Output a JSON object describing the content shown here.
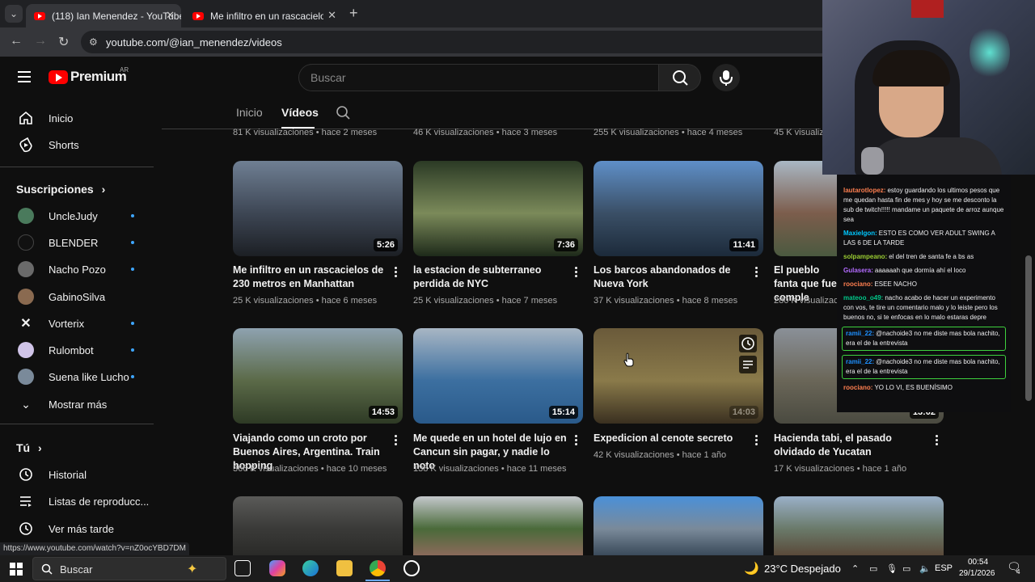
{
  "browser": {
    "tabs": [
      {
        "title": "(118) Ian Menendez - YouTube",
        "active": true
      },
      {
        "title": "Me infiltro en un rascacielos de",
        "active": false
      }
    ],
    "url": "youtube.com/@ian_menendez/videos",
    "status_url": "https://www.youtube.com/watch?v=nZ0ocYBD7DM"
  },
  "youtube": {
    "logo_text": "Premium",
    "country": "AR",
    "search_placeholder": "Buscar"
  },
  "sidebar": {
    "main": [
      {
        "label": "Inicio",
        "icon": "home-icon"
      },
      {
        "label": "Shorts",
        "icon": "shorts-icon"
      }
    ],
    "subscriptions_heading": "Suscripciones",
    "subscriptions": [
      {
        "label": "UncleJudy",
        "color": "#4a7a5c"
      },
      {
        "label": "BLENDER",
        "color": "#111111"
      },
      {
        "label": "Nacho Pozo",
        "color": "#6a6a6a"
      },
      {
        "label": "GabinoSilva",
        "color": "#8a6a50"
      },
      {
        "label": "Vorterix",
        "color": "#0f0f0f"
      },
      {
        "label": "Rulombot",
        "color": "#d0c4e8"
      },
      {
        "label": "Suena like Lucho",
        "color": "#7a8a9a"
      }
    ],
    "show_more": "Mostrar más",
    "you_heading": "Tú",
    "you": [
      {
        "label": "Historial",
        "icon": "history-icon"
      },
      {
        "label": "Listas de reproducc...",
        "icon": "playlists-icon"
      },
      {
        "label": "Ver más tarde",
        "icon": "watch-later-icon"
      }
    ]
  },
  "channel_tabs": [
    {
      "label": "Inicio",
      "active": false
    },
    {
      "label": "Videos",
      "display": "Vídeos",
      "active": true
    }
  ],
  "top_row_meta": [
    "81 K visualizaciones • hace 2 meses",
    "46 K visualizaciones • hace 3 meses",
    "255 K visualizaciones • hace 4 meses",
    "45 K visualiza"
  ],
  "videos_row1": [
    {
      "title": "Me infiltro en un rascacielos de 230 metros en Manhattan",
      "duration": "5:26",
      "views": "25 K visualizaciones",
      "age": "hace 6 meses",
      "colors": [
        "#6f7f93",
        "#3d4654",
        "#1c1f24"
      ]
    },
    {
      "title": "la estacion de subterraneo perdida de NYC",
      "duration": "7:36",
      "views": "25 K visualizaciones",
      "age": "hace 7 meses",
      "colors": [
        "#2b3a25",
        "#7b8a5a",
        "#1e2a1a"
      ]
    },
    {
      "title": "Los barcos abandonados de Nueva York",
      "duration": "11:41",
      "views": "37 K visualizaciones",
      "age": "hace 8 meses",
      "colors": [
        "#5f8fc8",
        "#3a4f66",
        "#1c2a3a"
      ]
    },
    {
      "title": "El pueblo fanta que fue comple",
      "duration": "",
      "views": "280 K visualizaciones",
      "age": "",
      "colors": [
        "#a9b7c4",
        "#7c5d4c",
        "#4b5a40"
      ]
    }
  ],
  "videos_row2": [
    {
      "title": "Viajando como un croto por Buenos Aires, Argentina. Train hopping",
      "duration": "14:53",
      "views": "366 K visualizaciones",
      "age": "hace 10 meses",
      "colors": [
        "#8ea2b0",
        "#5b6a48",
        "#2e3a25"
      ]
    },
    {
      "title": "Me quede en un hotel de lujo en Cancun sin pagar, y nadie lo noto",
      "duration": "15:14",
      "views": "138 K visualizaciones",
      "age": "hace 11 meses",
      "colors": [
        "#a8b6c4",
        "#3c6fa0",
        "#2a5a8a"
      ]
    },
    {
      "title": "Expedicion al cenote secreto",
      "duration": "14:03",
      "views": "42 K visualizaciones",
      "age": "hace 1 año",
      "colors": [
        "#6a5a3a",
        "#8a7a4a",
        "#3a3020"
      ]
    },
    {
      "title": "Hacienda tabi, el pasado olvidado de Yucatan",
      "duration": "13:02",
      "views": "17 K visualizaciones",
      "age": "hace 1 año",
      "colors": [
        "#8a9098",
        "#6a6658",
        "#4a4a40"
      ]
    }
  ],
  "videos_row3": [
    {
      "colors": [
        "#5a5a58",
        "#3a3a38",
        "#2a2a28"
      ]
    },
    {
      "colors": [
        "#c4c8cc",
        "#4a6a3a",
        "#8a6a5a"
      ]
    },
    {
      "colors": [
        "#4a90d8",
        "#7a8a9a",
        "#3a4a5a"
      ]
    },
    {
      "colors": [
        "#9ab0c8",
        "#6a7a6a",
        "#5a4a3a"
      ]
    }
  ],
  "chat": [
    {
      "user": "lautarotlopez:",
      "color": "#ff7f50",
      "text": "estoy guardando los ultimos pesos que me quedan hasta fin de mes y hoy se me desconto la sub de twitch!!!!! mandame un paquete de arroz aunque sea",
      "hl": false
    },
    {
      "user": "Maxielgon:",
      "color": "#00c8ff",
      "text": "ESTO ES COMO VER ADULT SWING A LAS 6 DE LA TARDE",
      "hl": false
    },
    {
      "user": "solpampeano:",
      "color": "#9acd32",
      "text": "el del tren de santa fe a bs as",
      "hl": false
    },
    {
      "user": "Gulasera:",
      "color": "#b36bff",
      "text": "aaaaaah que dormía ahí el loco",
      "hl": false
    },
    {
      "user": "roociano:",
      "color": "#ff7f50",
      "text": "ESEE NACHO",
      "hl": false
    },
    {
      "user": "mateoo_o49:",
      "color": "#00c88a",
      "text": "nacho acabo de hacer un experimento con vos, te tire un comentario malo y lo leiste pero los buenos no, si te enfocas en lo malo estaras depre",
      "hl": false
    },
    {
      "user": "ramii_22:",
      "color": "#1e90ff",
      "text": "@nachoide3 no me diste mas bola nachito, era el de la entrevista",
      "hl": true
    },
    {
      "user": "ramii_22:",
      "color": "#1e90ff",
      "text": "@nachoide3 no me diste mas bola nachito, era el de la entrevista",
      "hl": true
    },
    {
      "user": "roociano:",
      "color": "#ff7f50",
      "text": "YO LO VI, ES BUENÍSIMO",
      "hl": false
    }
  ],
  "taskbar": {
    "search": "Buscar",
    "weather": "23°C  Despejado",
    "lang": "ESP",
    "time": "00:54",
    "date": "29/1/2026",
    "notifications": "4"
  }
}
